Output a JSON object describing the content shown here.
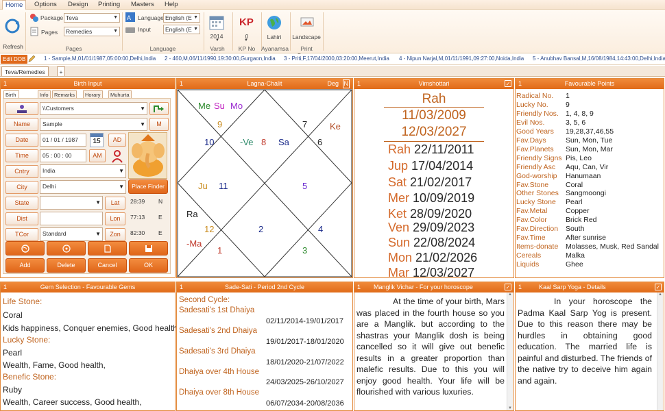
{
  "menu": {
    "tabs": [
      "Home",
      "Options",
      "Design",
      "Printing",
      "Masters",
      "Help"
    ]
  },
  "ribbon": {
    "refresh_label": "Refresh",
    "package_label": "Package",
    "package_value": "Teva",
    "pages_label": "Pages",
    "pages_value": "Remedies",
    "pages_group": "Pages",
    "language_label": "Language",
    "language_value": "English (E",
    "input_label": "Input",
    "input_value": "English (E",
    "language_group": "Language",
    "year_value": "2014",
    "varsh_group": "Varsh Year",
    "kp_value": "0",
    "kp_group": "KP No",
    "lahiri_label": "Lahiri",
    "ayanamsa_group": "Ayanamsa",
    "landscape_label": "Landscape",
    "print_group": "Print Screen"
  },
  "persons": {
    "edit_label": "Edit DOB",
    "items": [
      "1 - Sample,M,01/01/1987,05:00:00,Delhi,India",
      "2 - 460,M,06/11/1990,19:30:00,Gurgaon,India",
      "3 - Priti,F,17/04/2000,03:20:00,Meerut,India",
      "4 - Nipun Narjal,M,01/11/1991,09:27:00,Noida,India",
      "5 - Anubhav Bansal,M,16/08/1984,14:43:00,Delhi,India"
    ]
  },
  "doc_tab": "Teva/Remedies",
  "birth_input": {
    "title": "Birth Input",
    "num": "1",
    "tabs": [
      "Birth Input",
      "Info",
      "Remarks",
      "Horary",
      "Muhurta"
    ],
    "folder_value": "\\\\Customers",
    "name_label": "Name",
    "name_value": "Sample",
    "gender_value": "M",
    "date_label": "Date",
    "date_value": "01 / 01 / 1987",
    "calendar_day": "15",
    "ad_label": "AD",
    "time_label": "Time",
    "time_value": "05 : 00 : 00",
    "am_label": "AM",
    "country_label": "Cntry",
    "country_value": "India",
    "city_label": "City",
    "city_value": "Delhi",
    "place_finder_label": "Place Finder",
    "state_label": "State",
    "lat_label": "Lat",
    "lat_value": "28:39",
    "lat_dir": "N",
    "dist_label": "Dist",
    "lon_label": "Lon",
    "lon_value": "77:13",
    "lon_dir": "E",
    "tcor_label": "TCor",
    "tcor_value": "Standard",
    "zon_label": "Zon",
    "zon_value": "82:30",
    "zon_dir": "E",
    "add_label": "Add",
    "delete_label": "Delete",
    "cancel_label": "Cancel",
    "ok_label": "OK"
  },
  "lagna": {
    "title": "Lagna-Chalit",
    "num": "1",
    "deg_label": "Deg",
    "n_label": "N",
    "planets": {
      "me": "Me",
      "su": "Su",
      "mo": "Mo",
      "ke": "Ke",
      "ju": "Ju",
      "ra": "Ra",
      "ma": "-Ma",
      "ve": "-Ve",
      "sa": "Sa"
    },
    "houses": [
      "9",
      "7",
      "10",
      "8",
      "6",
      "11",
      "5",
      "12",
      "2",
      "4",
      "1",
      "3"
    ]
  },
  "vimshottari": {
    "title": "Vimshottari",
    "num": "1",
    "current": "Rah",
    "from": "11/03/2009",
    "to": "12/03/2027",
    "rows": [
      {
        "planet": "Rah",
        "date": "22/11/2011"
      },
      {
        "planet": "Jup",
        "date": "17/04/2014"
      },
      {
        "planet": "Sat",
        "date": "21/02/2017"
      },
      {
        "planet": "Mer",
        "date": "10/09/2019"
      },
      {
        "planet": "Ket",
        "date": "28/09/2020"
      },
      {
        "planet": "Ven",
        "date": "29/09/2023"
      },
      {
        "planet": "Sun",
        "date": "22/08/2024"
      },
      {
        "planet": "Mon",
        "date": "21/02/2026"
      },
      {
        "planet": "Mar",
        "date": "12/03/2027"
      }
    ]
  },
  "favourable": {
    "title": "Favourable Points",
    "num": "1",
    "rows": [
      {
        "k": "Radical No.",
        "v": "1"
      },
      {
        "k": "Lucky No.",
        "v": "9"
      },
      {
        "k": "Friendly Nos.",
        "v": "1, 4, 8, 9"
      },
      {
        "k": "Evil Nos.",
        "v": "3, 5, 6"
      },
      {
        "k": "Good Years",
        "v": "19,28,37,46,55"
      },
      {
        "k": "Fav.Days",
        "v": "Sun, Mon, Tue"
      },
      {
        "k": "Fav.Planets",
        "v": "Sun, Mon, Mar"
      },
      {
        "k": "Friendly Signs",
        "v": "Pis, Leo"
      },
      {
        "k": "Friendly Asc",
        "v": "Aqu, Can, Vir"
      },
      {
        "k": "God-worship",
        "v": "Hanumaan"
      },
      {
        "k": "Fav.Stone",
        "v": "Coral"
      },
      {
        "k": "Other Stones",
        "v": "Sangmoongi"
      },
      {
        "k": "Lucky Stone",
        "v": "Pearl"
      },
      {
        "k": "Fav.Metal",
        "v": "Copper"
      },
      {
        "k": "Fav.Color",
        "v": "Brick Red"
      },
      {
        "k": "Fav.Direction",
        "v": "South"
      },
      {
        "k": "Fav.Time",
        "v": "After sunrise"
      },
      {
        "k": "Items-donate",
        "v": "Molasses, Musk, Red Sandal"
      },
      {
        "k": "Cereals",
        "v": "Malka"
      },
      {
        "k": "Liquids",
        "v": "Ghee"
      }
    ]
  },
  "gem": {
    "title": "Gem Selection - Favourable Gems",
    "num": "1",
    "life_label": "Life Stone:",
    "life_value": "Coral",
    "life_benefit": "Kids happiness, Conquer enemies, Good health,",
    "lucky_label": "Lucky Stone:",
    "lucky_value": "Pearl",
    "lucky_benefit": "Wealth, Fame, Good health,",
    "benefic_label": "Benefic Stone:",
    "benefic_value": "Ruby",
    "benefic_benefit": "Wealth, Career success, Good health,"
  },
  "sadesati": {
    "title": "Sade-Sati - Period 2nd Cycle",
    "num": "1",
    "heading": "Second Cycle:",
    "rows": [
      {
        "label": "Sadesati's 1st Dhaiya",
        "dates": "02/11/2014-19/01/2017"
      },
      {
        "label": "Sadesati's 2nd Dhaiya",
        "dates": "19/01/2017-18/01/2020"
      },
      {
        "label": "Sadesati's 3rd Dhaiya",
        "dates": "18/01/2020-21/07/2022"
      },
      {
        "label": "Dhaiya over 4th House",
        "dates": "24/03/2025-26/10/2027"
      },
      {
        "label": "Dhaiya over 8th House",
        "dates": "06/07/2034-20/08/2036"
      }
    ]
  },
  "manglik": {
    "title": "Manglik Vichar - For your horoscope",
    "num": "1",
    "text": "At the time of your birth, Mars was placed in the fourth house so you are a Manglik. but according to the shastras your Manglik dosh is being cancelled so it will give out benefic results in a greater proportion than malefic results. Due to this you will enjoy good health. Your life will be flourished with various luxuries."
  },
  "kaalsarp": {
    "title": "Kaal Sarp Yoga - Details",
    "num": "1",
    "text": "In your horoscope the Padma Kaal Sarp Yog is present. Due to this reason there may be hurdles in obtaining good education. The married life is painful and disturbed. The friends of the native try to deceive him again and again."
  },
  "colors": {
    "accent": "#e06b18",
    "label_orange": "#c0641f",
    "red_planet": "#c0392b"
  }
}
